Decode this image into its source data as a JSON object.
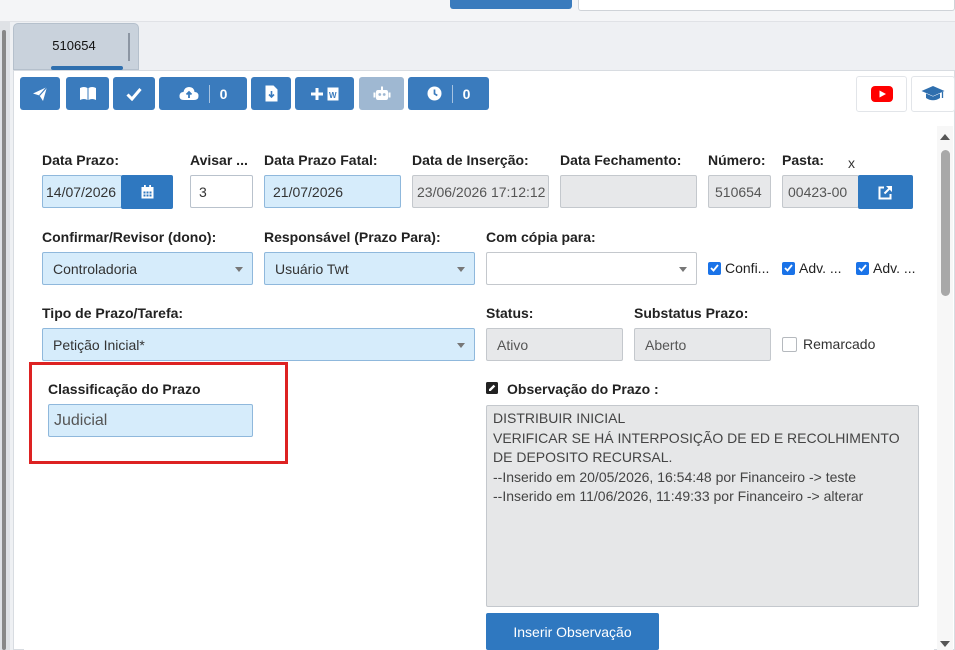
{
  "tab": {
    "label": "510654"
  },
  "toolbar": {
    "upload_count": "0",
    "clock_count": "0"
  },
  "form": {
    "data_prazo": {
      "label": "Data Prazo:",
      "value": "14/07/2026"
    },
    "avisar": {
      "label": "Avisar ...",
      "value": "3"
    },
    "data_prazo_fatal": {
      "label": "Data Prazo Fatal:",
      "value": "21/07/2026"
    },
    "data_insercao": {
      "label": "Data de Inserção:",
      "value": "23/06/2026 17:12:12"
    },
    "data_fechamento": {
      "label": "Data Fechamento:",
      "value": ""
    },
    "numero": {
      "label": "Número:",
      "value": "510654"
    },
    "pasta": {
      "label": "Pasta:",
      "value": "00423-00",
      "clear": "x"
    },
    "confirmar_revisor": {
      "label": "Confirmar/Revisor (dono):",
      "value": "Controladoria"
    },
    "responsavel": {
      "label": "Responsável (Prazo Para):",
      "value": "Usuário Twt"
    },
    "com_copia": {
      "label": "Com cópia para:",
      "value": ""
    },
    "checks": [
      {
        "label": "Confi...",
        "checked": true
      },
      {
        "label": "Adv. ...",
        "checked": true
      },
      {
        "label": "Adv. ...",
        "checked": true
      }
    ],
    "tipo_prazo": {
      "label": "Tipo de Prazo/Tarefa:",
      "value": "Petição Inicial*"
    },
    "status": {
      "label": "Status:",
      "value": "Ativo"
    },
    "substatus": {
      "label": "Substatus Prazo:",
      "value": "Aberto"
    },
    "remarcado": {
      "label": "Remarcado",
      "checked": false
    },
    "classificacao": {
      "label": "Classificação do Prazo",
      "value": "Judicial"
    },
    "observacao": {
      "label": "Observação do Prazo :",
      "lines": [
        "DISTRIBUIR INICIAL",
        "VERIFICAR SE HÁ INTERPOSIÇÃO DE ED E RECOLHIMENTO DE DEPOSITO RECURSAL.",
        "--Inserido em 20/05/2026, 16:54:48 por Financeiro -> teste",
        "--Inserido em 11/06/2026, 11:49:33 por Financeiro -> alterar"
      ]
    },
    "inserir_btn": "Inserir Observação"
  },
  "colors": {
    "primary": "#3a7bbd",
    "field_blue": "#d6ecfb",
    "highlight_red": "#dd2222",
    "youtube_red": "#ff0000"
  }
}
